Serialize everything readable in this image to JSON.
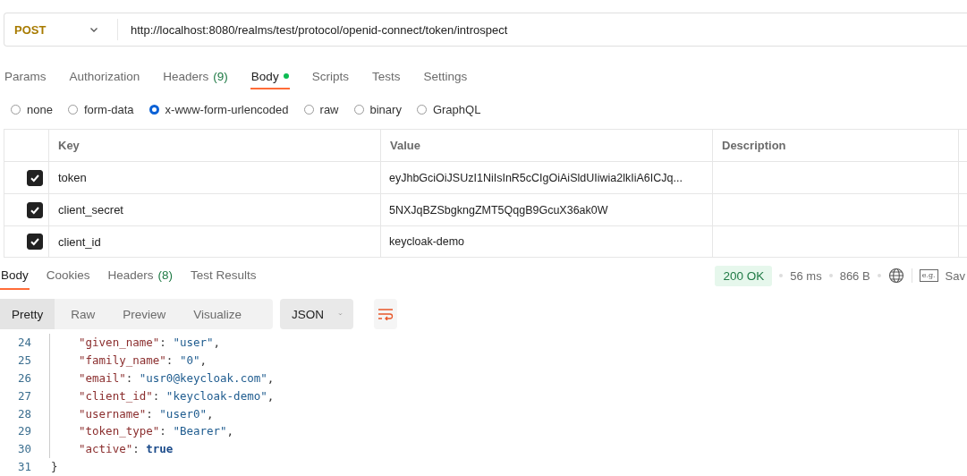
{
  "request": {
    "method": "POST",
    "url": "http://localhost:8080/realms/test/protocol/openid-connect/token/introspect"
  },
  "request_tabs": [
    {
      "label": "Params",
      "selected": false
    },
    {
      "label": "Authorization",
      "selected": false
    },
    {
      "label": "Headers",
      "count": "(9)",
      "selected": false
    },
    {
      "label": "Body",
      "selected": true,
      "indicator": true
    },
    {
      "label": "Scripts",
      "selected": false
    },
    {
      "label": "Tests",
      "selected": false
    },
    {
      "label": "Settings",
      "selected": false
    }
  ],
  "body_types": [
    {
      "label": "none",
      "selected": false
    },
    {
      "label": "form-data",
      "selected": false
    },
    {
      "label": "x-www-form-urlencoded",
      "selected": true
    },
    {
      "label": "raw",
      "selected": false
    },
    {
      "label": "binary",
      "selected": false
    },
    {
      "label": "GraphQL",
      "selected": false
    }
  ],
  "params_table": {
    "columns": [
      "Key",
      "Value",
      "Description"
    ],
    "rows": [
      {
        "checked": true,
        "key": "token",
        "value": "eyJhbGciOiJSUzI1NiIsInR5cCIgOiAiSldUIiwia2lkIiA6ICJq..."
      },
      {
        "checked": true,
        "key": "client_secret",
        "value": "5NXJqBZSbgkngZMT5QqgB9GcuX36ak0W"
      },
      {
        "checked": true,
        "key": "client_id",
        "value": "keycloak-demo"
      }
    ]
  },
  "response_tabs": [
    {
      "label": "Body",
      "selected": true
    },
    {
      "label": "Cookies",
      "selected": false
    },
    {
      "label": "Headers",
      "count": "(8)",
      "selected": false
    },
    {
      "label": "Test Results",
      "selected": false
    }
  ],
  "response_status": {
    "status": "200 OK",
    "time": "56 ms",
    "size": "866 B",
    "save_icon_text": "e.g.",
    "save_label": "Sav"
  },
  "view_modes": [
    {
      "label": "Pretty",
      "selected": true
    },
    {
      "label": "Raw",
      "selected": false
    },
    {
      "label": "Preview",
      "selected": false
    },
    {
      "label": "Visualize",
      "selected": false
    }
  ],
  "format": "JSON",
  "code_lines": [
    {
      "number": "24",
      "tokens": [
        {
          "kind": "key",
          "text": "\"given_name\""
        },
        {
          "kind": "punct",
          "text": ": "
        },
        {
          "kind": "string",
          "text": "\"user\""
        },
        {
          "kind": "punct",
          "text": ","
        }
      ]
    },
    {
      "number": "25",
      "tokens": [
        {
          "kind": "key",
          "text": "\"family_name\""
        },
        {
          "kind": "punct",
          "text": ": "
        },
        {
          "kind": "string",
          "text": "\"0\""
        },
        {
          "kind": "punct",
          "text": ","
        }
      ]
    },
    {
      "number": "26",
      "tokens": [
        {
          "kind": "key",
          "text": "\"email\""
        },
        {
          "kind": "punct",
          "text": ": "
        },
        {
          "kind": "string",
          "text": "\"usr0@keycloak.com\""
        },
        {
          "kind": "punct",
          "text": ","
        }
      ]
    },
    {
      "number": "27",
      "tokens": [
        {
          "kind": "key",
          "text": "\"client_id\""
        },
        {
          "kind": "punct",
          "text": ": "
        },
        {
          "kind": "string",
          "text": "\"keycloak-demo\""
        },
        {
          "kind": "punct",
          "text": ","
        }
      ]
    },
    {
      "number": "28",
      "tokens": [
        {
          "kind": "key",
          "text": "\"username\""
        },
        {
          "kind": "punct",
          "text": ": "
        },
        {
          "kind": "string",
          "text": "\"user0\""
        },
        {
          "kind": "punct",
          "text": ","
        }
      ]
    },
    {
      "number": "29",
      "tokens": [
        {
          "kind": "key",
          "text": "\"token_type\""
        },
        {
          "kind": "punct",
          "text": ": "
        },
        {
          "kind": "string",
          "text": "\"Bearer\""
        },
        {
          "kind": "punct",
          "text": ","
        }
      ]
    },
    {
      "number": "30",
      "tokens": [
        {
          "kind": "key",
          "text": "\"active\""
        },
        {
          "kind": "punct",
          "text": ": "
        },
        {
          "kind": "boolean",
          "text": "true"
        }
      ]
    },
    {
      "number": "31",
      "outdent": true,
      "tokens": [
        {
          "kind": "punct",
          "text": "}"
        }
      ]
    }
  ]
}
